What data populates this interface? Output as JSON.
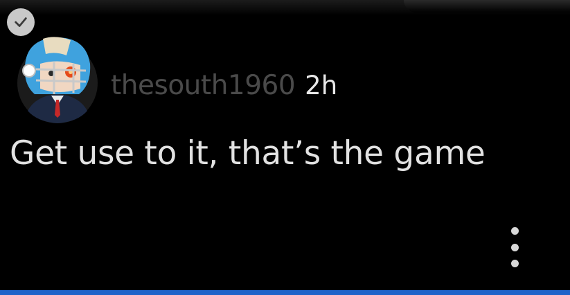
{
  "comment": {
    "username": "thesouth1960",
    "timestamp": "2h",
    "text": "Get use to it, that’s the game"
  },
  "icons": {
    "badge": "checkmark-icon",
    "avatar": "football-helmet-avatar",
    "menu": "more-vertical-icon"
  },
  "colors": {
    "background": "#000000",
    "text": "#e2e2e2",
    "username": "#4a4a4a",
    "accent_bar": "#1f63c9"
  }
}
